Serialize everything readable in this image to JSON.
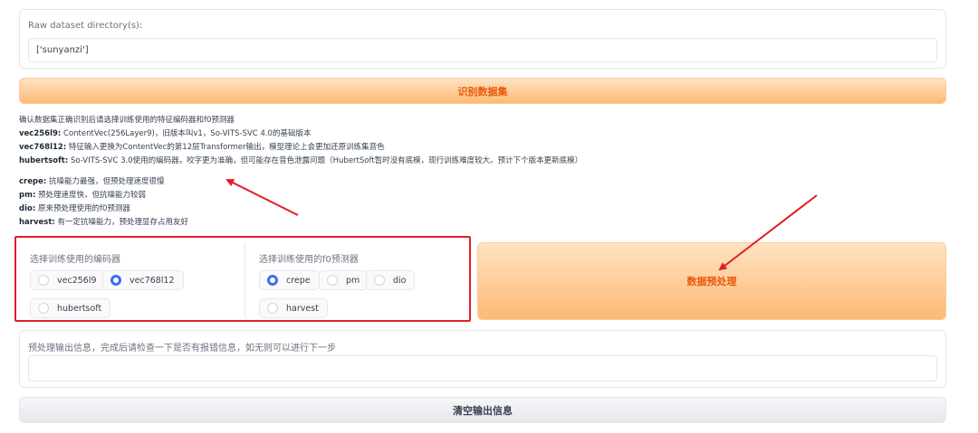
{
  "dataset": {
    "label": "Raw dataset directory(s):",
    "value": "['sunyanzi']"
  },
  "identify_button": "识别数据集",
  "info_lines": [
    {
      "key": "",
      "text": "确认数据集正确识别后请选择训练使用的特征编码器和f0预测器"
    },
    {
      "key": "vec256l9:",
      "text": " ContentVec(256Layer9)，旧版本叫v1，So-VITS-SVC 4.0的基础版本"
    },
    {
      "key": "vec768l12:",
      "text": " 特征输入更换为ContentVec的第12层Transformer输出，模型理论上会更加还原训练集音色"
    },
    {
      "key": "hubertsoft:",
      "text": " So-VITS-SVC 3.0使用的编码器，咬字更为准确，但可能存在音色泄露问题（HubertSoft暂时没有底模，现行训练难度较大。预计下个版本更新底模）"
    },
    {
      "key": "crepe:",
      "text": " 抗噪能力最强，但预处理速度很慢"
    },
    {
      "key": "pm:",
      "text": " 预处理速度快，但抗噪能力较弱"
    },
    {
      "key": "dio:",
      "text": " 原来预处理使用的f0预测器"
    },
    {
      "key": "harvest:",
      "text": " 有一定抗噪能力，预处理显存占用友好"
    }
  ],
  "encoder": {
    "label": "选择训练使用的编码器",
    "options": [
      "vec256l9",
      "vec768l12",
      "hubertsoft"
    ],
    "selected": "vec768l12"
  },
  "f0": {
    "label": "选择训练使用的f0预测器",
    "options": [
      "crepe",
      "pm",
      "dio",
      "harvest"
    ],
    "selected": "crepe"
  },
  "preprocess_button": "数据预处理",
  "output": {
    "label": "预处理输出信息，完成后请检查一下是否有报错信息，如无则可以进行下一步",
    "value": ""
  },
  "clear_button": "清空输出信息",
  "colors": {
    "accent": "#ea580c",
    "radio_checked": "#3b6ff0",
    "annotation": "#e11d28"
  }
}
